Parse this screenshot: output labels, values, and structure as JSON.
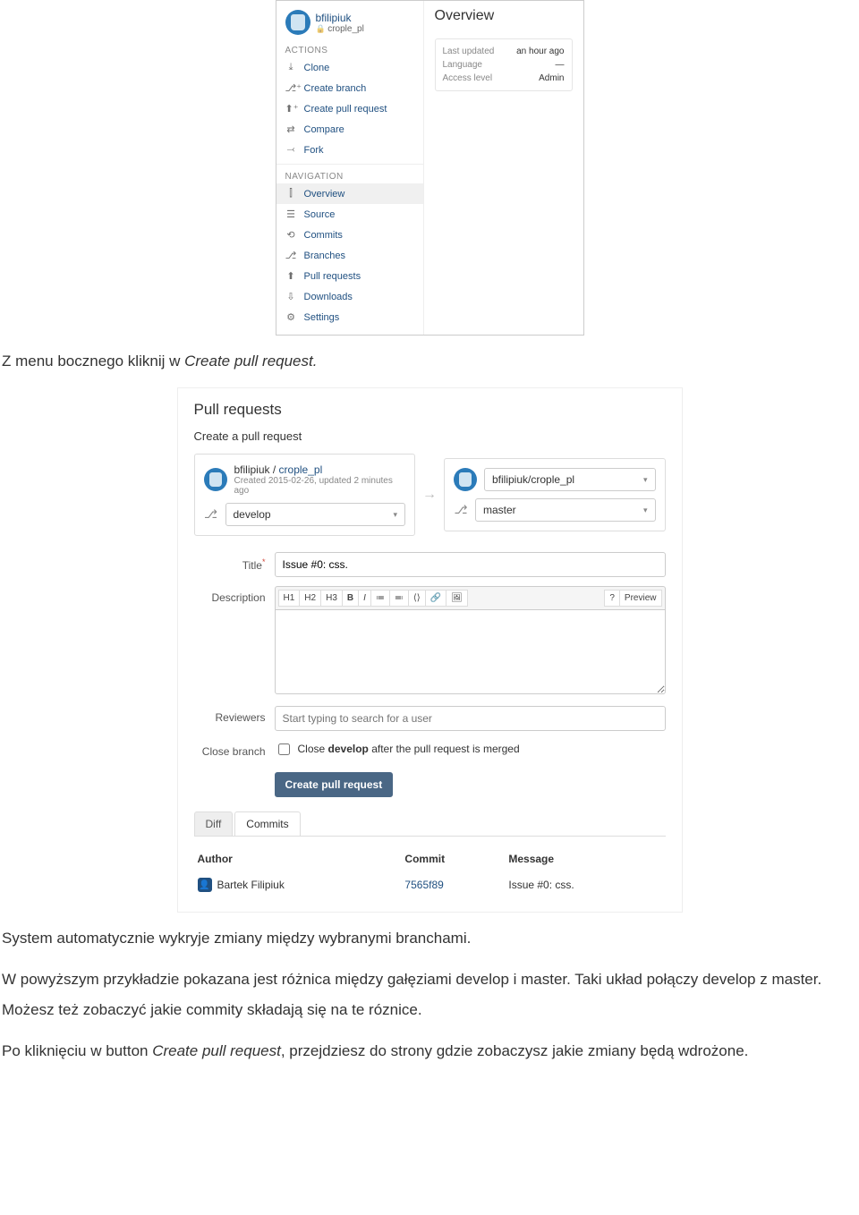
{
  "screenshot1": {
    "user": "bfilipiuk",
    "repo": "crople_pl",
    "actions_label": "ACTIONS",
    "actions": [
      {
        "icon": "⤓",
        "label": "Clone"
      },
      {
        "icon": "⎇⁺",
        "label": "Create branch"
      },
      {
        "icon": "⬆⁺",
        "label": "Create pull request"
      },
      {
        "icon": "⇄",
        "label": "Compare"
      },
      {
        "icon": "⤙",
        "label": "Fork"
      }
    ],
    "nav_label": "NAVIGATION",
    "nav": [
      {
        "icon": "⫿",
        "label": "Overview",
        "active": true
      },
      {
        "icon": "☰",
        "label": "Source"
      },
      {
        "icon": "⟲",
        "label": "Commits"
      },
      {
        "icon": "⎇",
        "label": "Branches"
      },
      {
        "icon": "⬆",
        "label": "Pull requests"
      },
      {
        "icon": "⇩",
        "label": "Downloads"
      },
      {
        "icon": "⚙",
        "label": "Settings"
      }
    ],
    "main_title": "Overview",
    "card": [
      {
        "k": "Last updated",
        "v": "an hour ago"
      },
      {
        "k": "Language",
        "v": "—"
      },
      {
        "k": "Access level",
        "v": "Admin"
      }
    ]
  },
  "doc": {
    "p1a": "Z menu bocznego kliknij w ",
    "p1b": "Create pull request.",
    "p2": "System automatycznie wykryje zmiany między wybranymi branchami.",
    "p3": "W powyższym przykładzie pokazana jest różnica między gałęziami develop i master. Taki układ połączy develop z master. Możesz też zobaczyć jakie commity składają się na te róznice.",
    "p4a": "Po kliknięciu w button ",
    "p4b": "Create pull request",
    "p4c": ", przejdziesz do strony gdzie zobaczysz jakie zmiany będą wdrożone."
  },
  "screenshot2": {
    "h1": "Pull requests",
    "h2": "Create a pull request",
    "source": {
      "owner": "bfilipiuk",
      "repo": "crople_pl",
      "meta": "Created 2015-02-26, updated 2 minutes ago",
      "branch": "develop"
    },
    "target": {
      "path": "bfilipiuk/crople_pl",
      "branch": "master"
    },
    "labels": {
      "title": "Title",
      "description": "Description",
      "reviewers": "Reviewers",
      "close_branch": "Close branch"
    },
    "title_value": "Issue #0: css.",
    "toolbar": [
      "H1",
      "H2",
      "H3",
      "B",
      "I",
      "≔",
      "≕",
      "⟨⟩",
      "🔗",
      "🖼",
      "?",
      "Preview"
    ],
    "reviewers_placeholder": "Start typing to search for a user",
    "close_text_pre": "Close ",
    "close_text_branch": "develop",
    "close_text_post": " after the pull request is merged",
    "submit": "Create pull request",
    "tabs": [
      "Diff",
      "Commits"
    ],
    "table": {
      "cols": [
        "Author",
        "Commit",
        "Message"
      ],
      "rows": [
        {
          "author": "Bartek Filipiuk",
          "commit": "7565f89",
          "message": "Issue #0: css."
        }
      ]
    }
  }
}
